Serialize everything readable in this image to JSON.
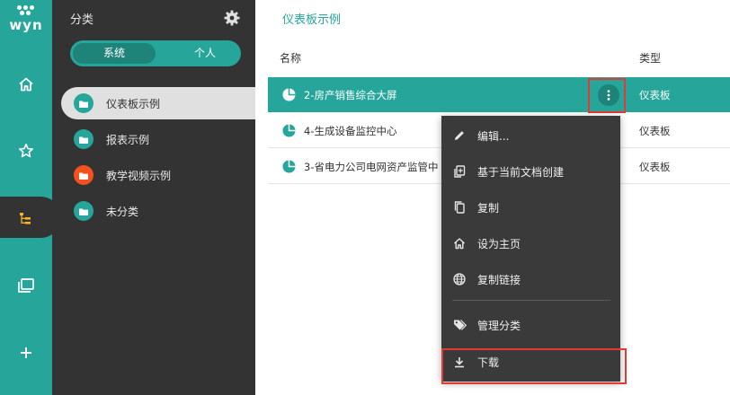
{
  "logo": {
    "text": "wyn"
  },
  "rail": {
    "icons": [
      "home-icon",
      "star-icon",
      "category-tree-icon",
      "folder-view-icon",
      "add-icon"
    ]
  },
  "category_panel": {
    "title": "分类",
    "tabs": {
      "system": "系统",
      "personal": "个人",
      "selected": "系统"
    },
    "items": [
      {
        "label": "仪表板示例",
        "color": "#26a69a",
        "active": true
      },
      {
        "label": "报表示例",
        "color": "#26a69a",
        "active": false
      },
      {
        "label": "教学视频示例",
        "color": "#f4511e",
        "active": false
      },
      {
        "label": "未分类",
        "color": "#26a69a",
        "active": false
      }
    ]
  },
  "main": {
    "breadcrumb": "仪表板示例",
    "columns": {
      "name": "名称",
      "type": "类型"
    },
    "rows": [
      {
        "name": "2-房产销售综合大屏",
        "type": "仪表板",
        "selected": true
      },
      {
        "name": "4-生成设备监控中心",
        "type": "仪表板",
        "selected": false
      },
      {
        "name": "3-省电力公司电网资产监管中",
        "type": "仪表板",
        "selected": false
      }
    ]
  },
  "context_menu": {
    "items": [
      {
        "label": "编辑...",
        "icon": "edit-icon"
      },
      {
        "label": "基于当前文档创建",
        "icon": "create-from-doc-icon"
      },
      {
        "label": "复制",
        "icon": "copy-icon"
      },
      {
        "label": "设为主页",
        "icon": "home-icon"
      },
      {
        "label": "复制链接",
        "icon": "globe-icon"
      },
      {
        "label": "管理分类",
        "icon": "tag-icon"
      },
      {
        "label": "下载",
        "icon": "download-icon"
      }
    ]
  },
  "colors": {
    "accent": "#26a69a",
    "panel": "#333333",
    "menu": "#3a3a3a",
    "highlight": "#e53935",
    "orange_folder": "#f4511e"
  }
}
